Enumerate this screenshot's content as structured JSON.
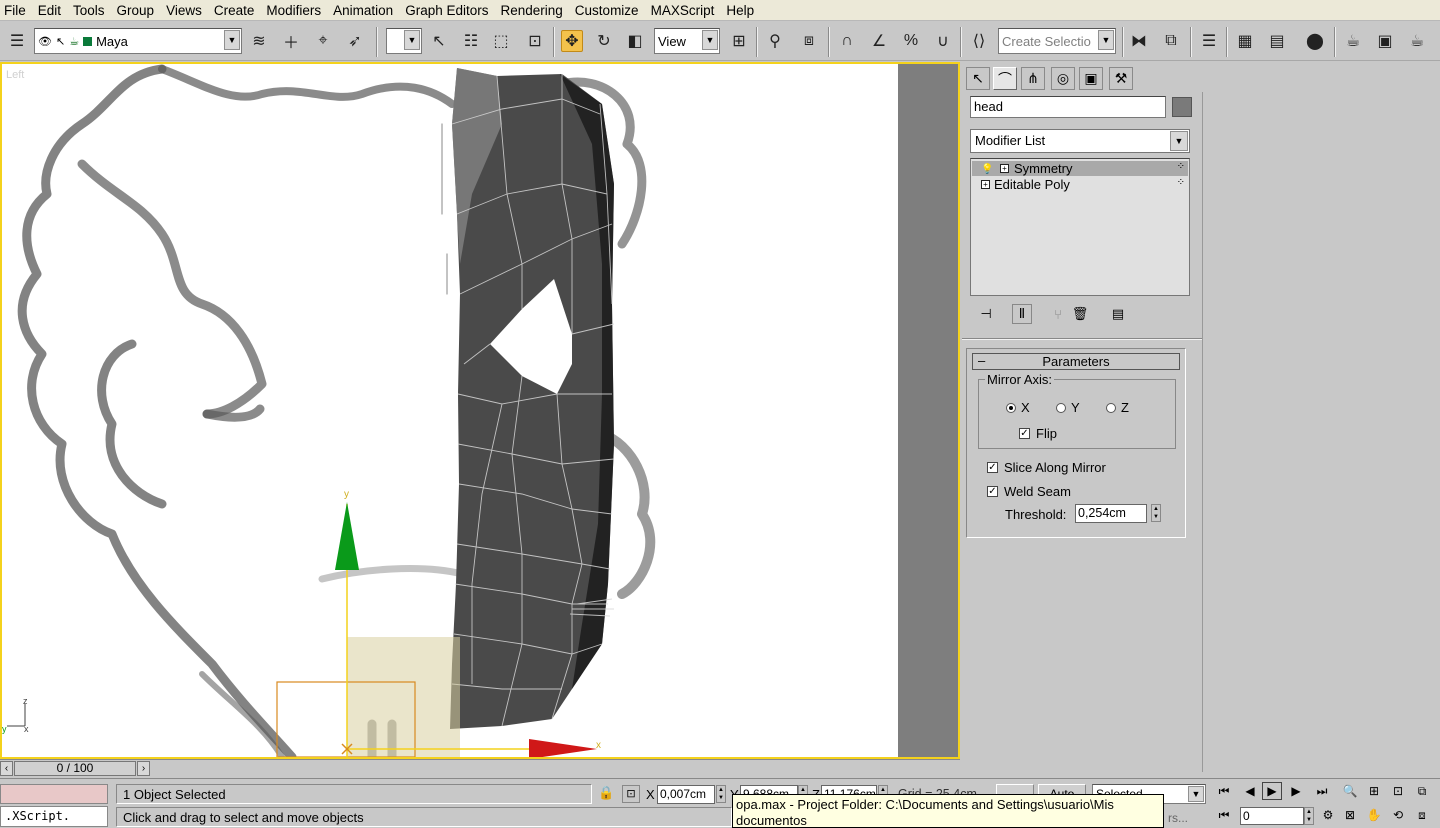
{
  "menu": [
    "File",
    "Edit",
    "Tools",
    "Group",
    "Views",
    "Create",
    "Modifiers",
    "Animation",
    "Graph Editors",
    "Rendering",
    "Customize",
    "MAXScript",
    "Help"
  ],
  "toolbar": {
    "layer_name": "Maya",
    "selection_filter": "",
    "ref_coord": "View",
    "named_selection_placeholder": "Create Selectio"
  },
  "viewport": {
    "label": "Left",
    "axis_y": "y",
    "axis_x": "x",
    "axis_z": "z",
    "mini_axis_y": "y",
    "mini_axis_x": "x",
    "colors": {
      "border_active": "#f4d21c",
      "gizmo_y": "#0a9a1a",
      "gizmo_x": "#d01818"
    }
  },
  "command_panel": {
    "object_name": "head",
    "modifier_list": "Modifier List",
    "stack": [
      {
        "label": "Symmetry",
        "selected": true
      },
      {
        "label": "Editable Poly",
        "selected": false
      }
    ],
    "params": {
      "title": "Parameters",
      "collapse": "–",
      "mirror_axis_label": "Mirror Axis:",
      "axes": [
        {
          "label": "X",
          "selected": true
        },
        {
          "label": "Y",
          "selected": false
        },
        {
          "label": "Z",
          "selected": false
        }
      ],
      "flip_label": "Flip",
      "flip_checked": true,
      "slice_label": "Slice Along Mirror",
      "slice_checked": true,
      "weld_label": "Weld Seam",
      "weld_checked": true,
      "threshold_label": "Threshold:",
      "threshold_value": "0,254cm"
    }
  },
  "timeline": {
    "frame_display": "0 / 100"
  },
  "status": {
    "maxscript": ".XScript.",
    "objects_selected": "1 Object Selected",
    "prompt": "Click and drag to select and move objects",
    "x_label": "X",
    "x_value": "0,007cm",
    "y_label": "Y",
    "y_value": "9,688cm",
    "z_label": "Z",
    "z_value": "11,176cm",
    "grid": "Grid = 25,4cm",
    "auto_key": "Auto",
    "set_key_mode": "Selected",
    "frame_value": "0",
    "filters_fragment": "rs..."
  },
  "tooltip": {
    "line1": "opa.max      - Project Folder: C:\\Documents and Settings\\usuario\\Mis",
    "line2": "documentos"
  }
}
